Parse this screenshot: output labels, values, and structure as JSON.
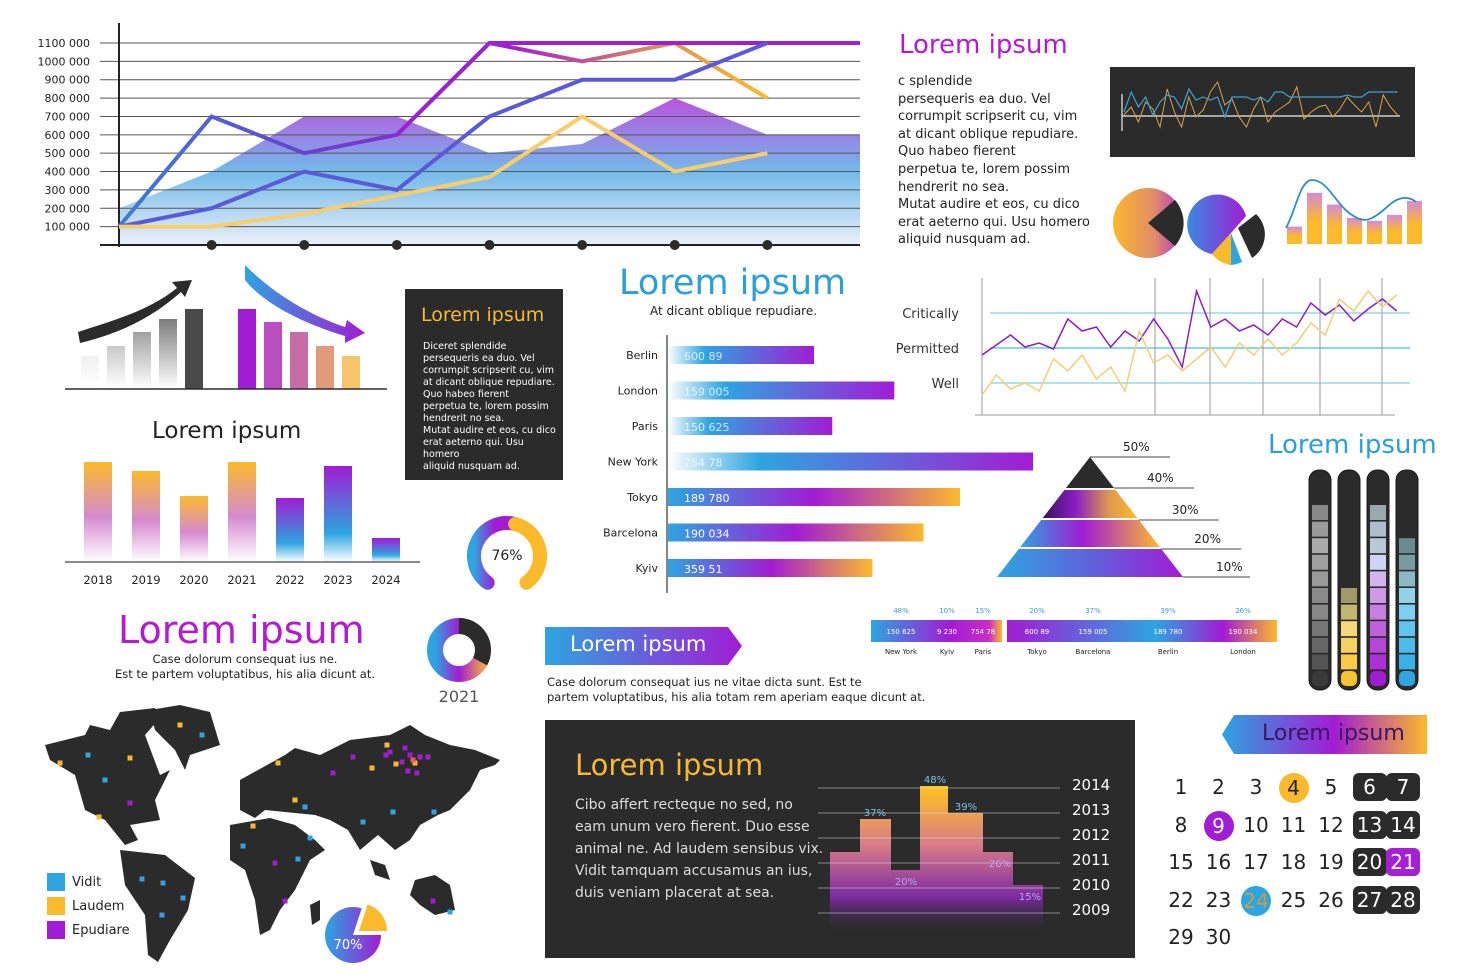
{
  "colors": {
    "purple": "#a21cd4",
    "blue": "#2ea4e0",
    "yellow": "#fbb92c",
    "dark": "#2b2b2b",
    "magenta": "#c21fc4"
  },
  "chart_data": [
    {
      "id": "main-line-area",
      "type": "line",
      "title": "",
      "ytick_labels": [
        "100 000",
        "200 000",
        "300 000",
        "400 000",
        "500 000",
        "600 000",
        "700 000",
        "800 000",
        "900 000",
        "1000 000",
        "1100 000"
      ],
      "ylim": [
        0,
        1100000
      ],
      "x": [
        0,
        1,
        2,
        3,
        4,
        5,
        6,
        7,
        8
      ],
      "x_markers": [
        1,
        2,
        3,
        4,
        5,
        6,
        7
      ],
      "grid": true,
      "area": {
        "name": "area",
        "values": [
          200000,
          400000,
          700000,
          700000,
          500000,
          550000,
          800000,
          600000,
          600000
        ]
      },
      "series": [
        {
          "name": "purple-top",
          "values": [
            100000,
            700000,
            500000,
            600000,
            1100000,
            1000000,
            1100000,
            800000,
            null
          ]
        },
        {
          "name": "violet",
          "values": [
            null,
            null,
            null,
            600000,
            1100000,
            null,
            null,
            null,
            1100000
          ]
        },
        {
          "name": "indigo",
          "values": [
            100000,
            200000,
            400000,
            300000,
            700000,
            900000,
            900000,
            1100000,
            null
          ]
        },
        {
          "name": "yellow",
          "values": [
            100000,
            100000,
            170000,
            270000,
            370000,
            700000,
            400000,
            500000,
            null
          ]
        }
      ]
    },
    {
      "id": "growth-bars",
      "type": "bar",
      "categories": [
        "1",
        "2",
        "3",
        "4",
        "5"
      ],
      "series": [
        {
          "name": "rising",
          "values": [
            33,
            43,
            57,
            70,
            80
          ]
        },
        {
          "name": "falling",
          "values": [
            80,
            67,
            57,
            43,
            33
          ]
        }
      ]
    },
    {
      "id": "yearly-bars",
      "type": "bar",
      "title": "Lorem ipsum",
      "categories": [
        "2018",
        "2019",
        "2020",
        "2021",
        "2022",
        "2023",
        "2024"
      ],
      "values": [
        100,
        91,
        66,
        100,
        64,
        96,
        24
      ],
      "ylim": [
        0,
        100
      ]
    },
    {
      "id": "gauge",
      "type": "pie",
      "label": "76%",
      "values": [
        76,
        24
      ]
    },
    {
      "id": "city-bars",
      "type": "bar",
      "title": "Lorem ipsum",
      "subtitle": "At dicant oblique repudiare.",
      "categories": [
        "Berlin",
        "London",
        "Paris",
        "New York",
        "Tokyo",
        "Barcelona",
        "Kyiv"
      ],
      "value_labels": [
        "600 89",
        "159 005",
        "150 625",
        "754 78",
        "189 780",
        "190 034",
        "359 51"
      ],
      "values": [
        40,
        62,
        45,
        100,
        80,
        70,
        56
      ]
    },
    {
      "id": "threshold-lines",
      "type": "line",
      "categories": [
        "Critically",
        "Permitted",
        "Well"
      ],
      "series": [
        {
          "name": "purple",
          "values": [
            30,
            35,
            40,
            34,
            36,
            33,
            48,
            42,
            44,
            34,
            42,
            37,
            48,
            38,
            24,
            62,
            44,
            48,
            42,
            45,
            40,
            48,
            44,
            56,
            50,
            55,
            47,
            53,
            58,
            52
          ]
        },
        {
          "name": "yellow",
          "values": [
            10,
            20,
            13,
            16,
            12,
            28,
            22,
            30,
            18,
            24,
            12,
            42,
            26,
            30,
            22,
            28,
            34,
            24,
            36,
            30,
            38,
            30,
            36,
            46,
            40,
            58,
            52,
            62,
            54,
            60
          ]
        }
      ]
    },
    {
      "id": "pyramid",
      "type": "bar",
      "categories": [
        "50%",
        "40%",
        "30%",
        "20%",
        "10%"
      ]
    },
    {
      "id": "level-meters",
      "type": "bar",
      "title": "Lorem ipsum",
      "series": [
        {
          "name": "gray",
          "values": [
            11
          ]
        },
        {
          "name": "yellow",
          "values": [
            6
          ]
        },
        {
          "name": "purple",
          "values": [
            11
          ]
        },
        {
          "name": "blue",
          "values": [
            9
          ]
        }
      ],
      "ylim": [
        0,
        11
      ]
    },
    {
      "id": "segment-strip",
      "type": "bar",
      "groups": [
        {
          "items": [
            {
              "city": "New York",
              "value": "150 625",
              "pct": "48%"
            },
            {
              "city": "Kyiv",
              "value": "9 230",
              "pct": "10%"
            },
            {
              "city": "Paris",
              "value": "754 78",
              "pct": "15%"
            }
          ]
        },
        {
          "items": [
            {
              "city": "Tokyo",
              "value": "600 89",
              "pct": "20%"
            },
            {
              "city": "Barcelona",
              "value": "159 005",
              "pct": "37%"
            },
            {
              "city": "Berlin",
              "value": "189 780",
              "pct": "39%"
            },
            {
              "city": "London",
              "value": "190 034",
              "pct": "26%"
            }
          ]
        }
      ]
    },
    {
      "id": "donut-2021",
      "type": "pie",
      "label": "2021",
      "values": [
        33,
        67
      ]
    },
    {
      "id": "step-chart",
      "type": "bar",
      "title": "Lorem ipsum",
      "ytick_labels": [
        "2014",
        "2013",
        "2012",
        "2011",
        "2010",
        "2009"
      ],
      "values": [
        26,
        37,
        20,
        48,
        39,
        26,
        15
      ],
      "data_labels": [
        "",
        "37%",
        "20%",
        "48%",
        "39%",
        "26%",
        "15%"
      ]
    },
    {
      "id": "world-map-pie",
      "type": "pie",
      "label": "70%",
      "values": [
        70,
        30
      ]
    },
    {
      "id": "mini-bars",
      "type": "bar",
      "values": [
        30,
        88,
        68,
        45,
        40,
        50,
        74
      ]
    }
  ],
  "top_text": {
    "title": "Lorem ipsum",
    "lines": [
      "c splendide",
      "persequeris ea duo. Vel",
      "corrumpit scripserit cu, vim",
      "at dicant oblique repudiare.",
      "Quo habeo fierent",
      "perpetua te, lorem possim",
      "hendrerit no sea.",
      "Mutat audire et eos, cu dico",
      "erat aeterno qui. Usu homero",
      "aliquid nusquam ad."
    ]
  },
  "dark_card": {
    "title": "Lorem ipsum",
    "lines": [
      "Diceret splendide",
      "persequeris ea duo. Vel",
      "corrumpit scripserit cu, vim",
      "at dicant oblique repudiare.",
      "Quo habeo fierent",
      "perpetua te, lorem possim",
      "hendrerit no sea.",
      "Mutat audire et eos, cu dico",
      "erat aeterno qui. Usu homero",
      "aliquid nusquam ad."
    ]
  },
  "yearly_title": "Lorem ipsum",
  "world": {
    "title": "Lorem ipsum",
    "lines": [
      "Case dolorum consequat ius ne.",
      "Est te partem voluptatibus, his alia dicunt at."
    ],
    "legend": [
      {
        "label": "Vidit",
        "color": "#2ea4e0"
      },
      {
        "label": "Laudem",
        "color": "#fbb92c"
      },
      {
        "label": "Epudiare",
        "color": "#a21cd4"
      }
    ]
  },
  "banner": {
    "title": "Lorem ipsum",
    "lines": [
      "Case dolorum consequat ius ne vitae dicta sunt.  Est te",
      "partem voluptatibus, his alia totam rem aperiam eaque  dicunt at."
    ]
  },
  "dark_panel": {
    "title": "Lorem ipsum",
    "lines": [
      "Cibo affert recteque no sed, no",
      "eam unum vero fierent. Duo esse",
      "animal ne. Ad laudem sensibus vix.",
      "Vidit tamquam accusamus an ius,",
      "duis veniam placerat at sea."
    ]
  },
  "calendar": {
    "title": "Lorem ipsum",
    "days": [
      "1",
      "2",
      "3",
      "4",
      "5",
      "6",
      "7",
      "8",
      "9",
      "10",
      "11",
      "12",
      "13",
      "14",
      "15",
      "16",
      "17",
      "18",
      "19",
      "20",
      "21",
      "22",
      "23",
      "24",
      "25",
      "26",
      "27",
      "28",
      "29",
      "30"
    ],
    "highlight_yellow": "4",
    "highlight_purple": "9",
    "highlight_blue": "24",
    "highlight_weekend_purple": "21"
  }
}
